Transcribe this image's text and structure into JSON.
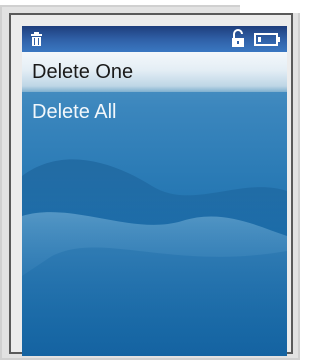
{
  "device": {
    "status_bar": {
      "icons": [
        "trash-can-icon",
        "unlock-icon",
        "battery-icon"
      ]
    },
    "menu": {
      "items": [
        {
          "label": "Delete One",
          "selected": true
        },
        {
          "label": "Delete All",
          "selected": false
        }
      ]
    },
    "colors": {
      "status_bar": "#2f5fa6",
      "selected_highlight": "#e4eef5",
      "screen_background": "#1b6fa9",
      "menu_text_selected": "#1a1a1a",
      "menu_text_normal": "#f2f7fb"
    }
  }
}
